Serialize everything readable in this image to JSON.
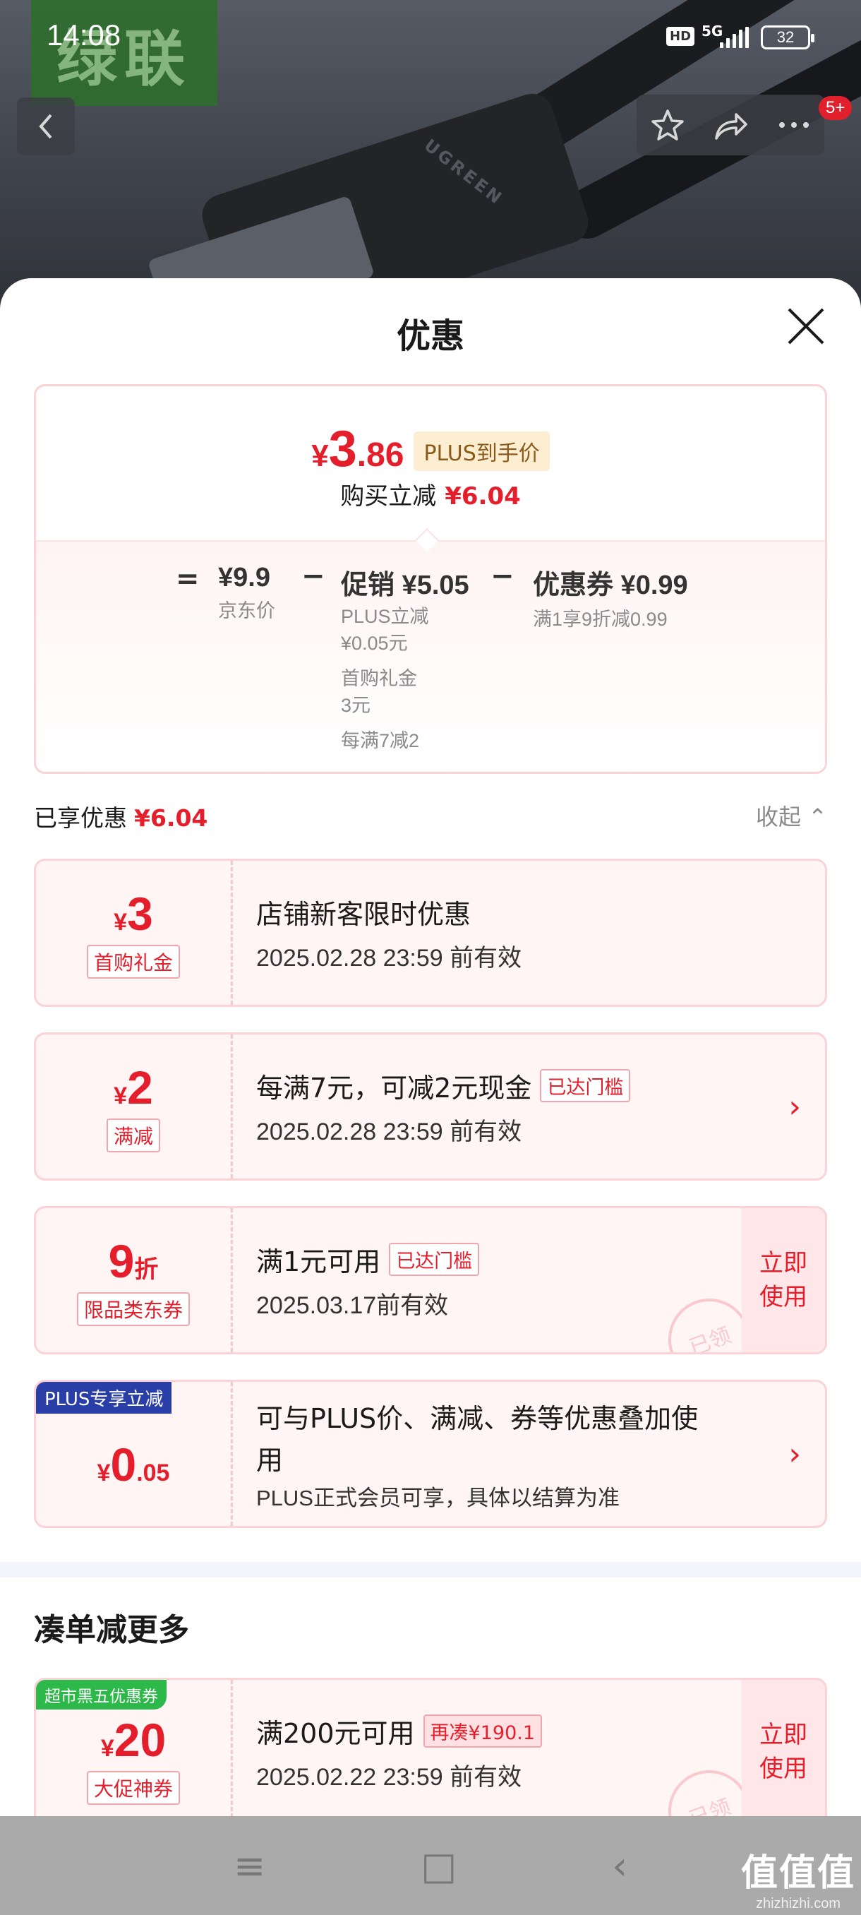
{
  "status": {
    "time": "14:08",
    "hd": "HD",
    "network": "5G",
    "battery": "32"
  },
  "hero": {
    "brand_logo": "绿联",
    "plug_text": "UGREEN",
    "notif_badge": "5+"
  },
  "header_icons": {
    "back": "chevron-left-icon",
    "favorite": "star-icon",
    "share": "share-icon",
    "more": "more-icon"
  },
  "sheet": {
    "title": "优惠",
    "close_icon": "close-icon"
  },
  "summary": {
    "currency": "¥",
    "price_int": "3",
    "price_dec": ".86",
    "plus_tag": "PLUS到手价",
    "reduce_label": "购买立减",
    "reduce_amount": "¥6.04",
    "equals": "=",
    "jd_price": "¥9.9",
    "jd_price_label": "京东价",
    "minus1": "−",
    "promo": "促销 ¥5.05",
    "promo_lines": [
      "PLUS立减",
      "¥0.05元",
      "首购礼金",
      "3元",
      "每满7减2"
    ],
    "minus2": "−",
    "coupon": "优惠券 ¥0.99",
    "coupon_line": "满1享9折减0.99"
  },
  "enjoyed": {
    "label": "已享优惠",
    "amount": "¥6.04",
    "collapse": "收起 ⌃"
  },
  "cards": [
    {
      "currency": "¥",
      "amount": "3",
      "tag": "首购礼金",
      "title": "店铺新客限时优惠",
      "sub": "2025.02.28 23:59 前有效"
    },
    {
      "currency": "¥",
      "amount": "2",
      "tag": "满减",
      "title": "每满7元，可减2元现金",
      "chip": "已达门槛",
      "sub": "2025.02.28 23:59 前有效",
      "arrow": "›"
    },
    {
      "amount": "9",
      "suffix": "折",
      "tag": "限品类东券",
      "title": "满1元可用",
      "chip": "已达门槛",
      "sub": "2025.03.17前有效",
      "use": [
        "立即",
        "使用"
      ],
      "stamp": "已领"
    },
    {
      "corner": "PLUS专享立减",
      "currency": "¥",
      "amount": "0",
      "suffix": ".05",
      "title1": "可与PLUS价、满减、券等优惠叠加使",
      "title2": "用",
      "sub": "PLUS正式会员可享，具体以结算为准",
      "arrow": "›"
    }
  ],
  "more": {
    "title": "凑单减更多",
    "card": {
      "corner": "超市黑五优惠券",
      "currency": "¥",
      "amount": "20",
      "tag": "大促神券",
      "title": "满200元可用",
      "chip": "再凑¥190.1",
      "sub": "2025.02.22 23:59 前有效",
      "use": [
        "立即",
        "使用"
      ],
      "stamp": "已领"
    }
  },
  "navbar": {
    "menu": "≡",
    "home": "□",
    "back": "‹"
  },
  "watermark": {
    "main": "值值值",
    "url": "zhizhizhi.com"
  },
  "colors": {
    "accent_red": "#e41e2b",
    "card_bg": "#fff5f5",
    "plus_blue": "#2a3ea8",
    "promo_green": "#2db84a"
  }
}
